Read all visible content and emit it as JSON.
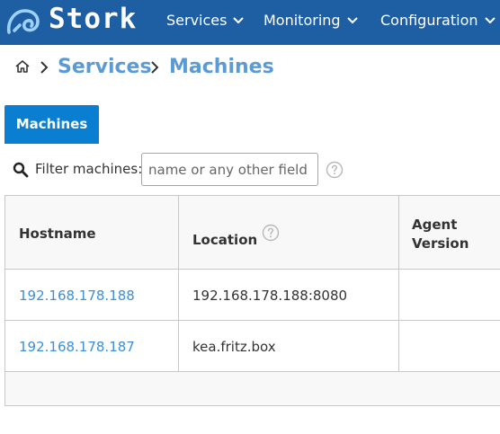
{
  "app": {
    "name": "Stork"
  },
  "nav": {
    "items": [
      {
        "label": "Services"
      },
      {
        "label": "Monitoring"
      },
      {
        "label": "Configuration"
      }
    ]
  },
  "breadcrumb": {
    "items": [
      {
        "label": "Services"
      },
      {
        "label": "Machines"
      }
    ]
  },
  "tabs": [
    {
      "label": "Machines",
      "active": true
    }
  ],
  "filter": {
    "label": "Filter machines:",
    "value": "",
    "placeholder": "name or any other field"
  },
  "table": {
    "columns": [
      {
        "label": "Hostname"
      },
      {
        "label": "Location"
      },
      {
        "label": "Agent Version"
      }
    ],
    "rows": [
      {
        "hostname": "192.168.178.188",
        "location": "192.168.178.188:8080",
        "agent_version": ""
      },
      {
        "hostname": "192.168.178.187",
        "location": "kea.fritz.box",
        "agent_version": ""
      }
    ]
  },
  "colors": {
    "topbar": "#1e5fa3",
    "accent": "#0a7fd1",
    "link": "#3c8fd8",
    "breadcrumb_link": "#5b9bd5"
  }
}
